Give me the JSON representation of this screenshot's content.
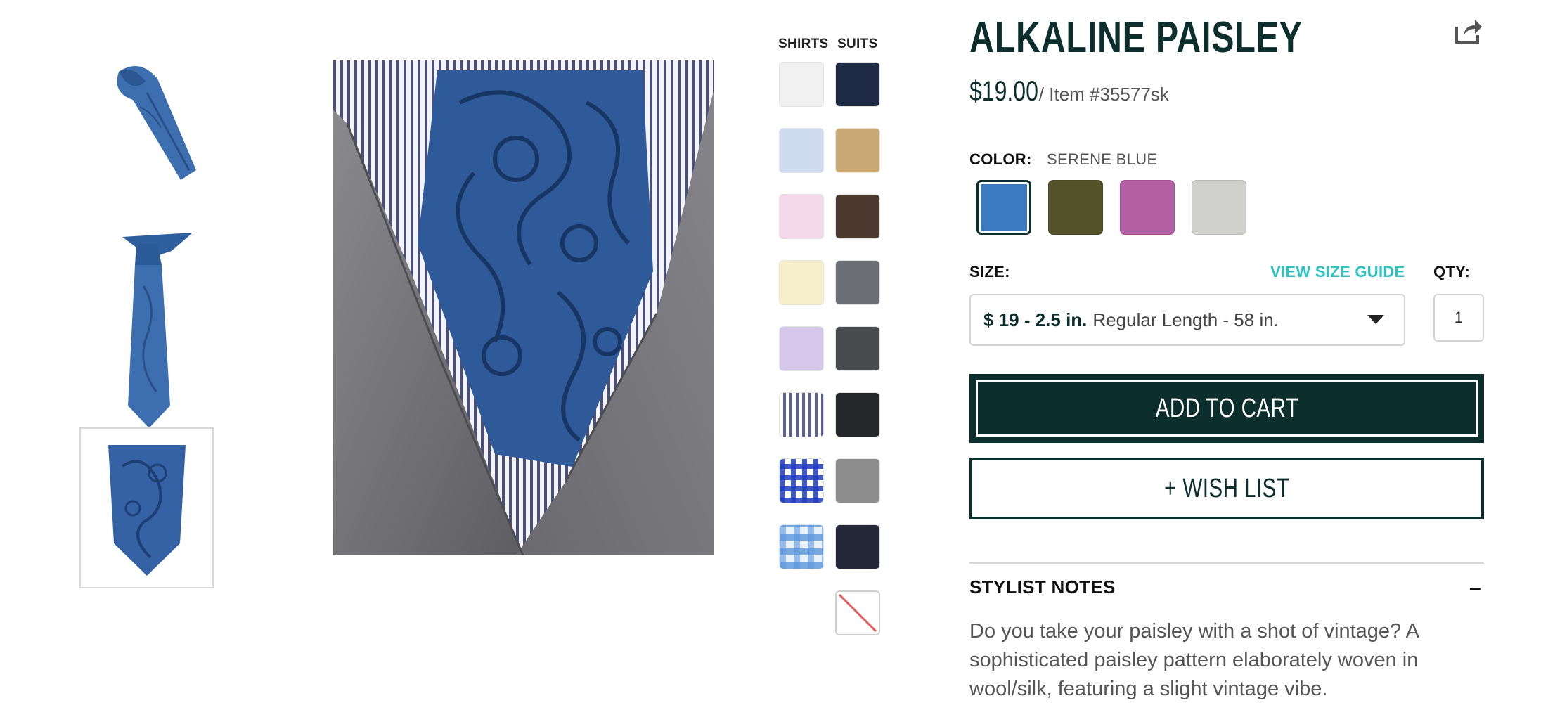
{
  "product": {
    "title": "ALKALINE PAISLEY",
    "price": "$19.00",
    "item_number": "/ Item #35577sk"
  },
  "swatches": {
    "shirts_label": "SHIRTS",
    "suits_label": "SUITS",
    "shirts": [
      "#f1f1f1",
      "#cfdcef",
      "#f4d9ea",
      "#f7efc9",
      "#d6c6ea",
      "stripe",
      "check",
      "plaid"
    ],
    "suits": [
      "#1f2a44",
      "#c9a874",
      "#4c3a30",
      "#6c6e76",
      "#4a4b4e",
      "#25272b",
      "#8d8d8d",
      "#252838",
      "none"
    ]
  },
  "color": {
    "label": "COLOR:",
    "selected": "SERENE BLUE",
    "options": [
      "#3b7abf",
      "#535128",
      "#b35fa4",
      "#d0d0cc"
    ]
  },
  "size": {
    "label": "SIZE:",
    "guide": "VIEW SIZE GUIDE",
    "price": "$ 19 - 2.5 in.",
    "desc": "Regular Length - 58 in."
  },
  "qty": {
    "label": "QTY:",
    "value": "1"
  },
  "actions": {
    "add_to_cart": "ADD TO CART",
    "wish_list": "+ WISH LIST"
  },
  "notes": {
    "title": "STYLIST NOTES",
    "toggle": "–",
    "body": "Do you take your paisley with a shot of vintage? A sophisticated paisley pattern elaborately woven in wool/silk, featuring a slight vintage vibe."
  }
}
